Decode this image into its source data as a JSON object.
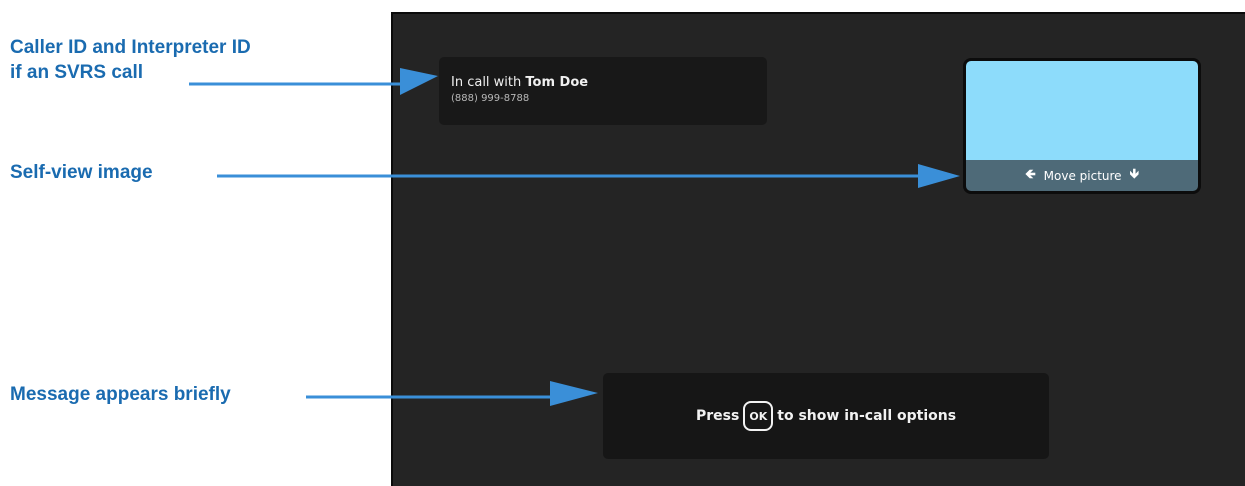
{
  "callouts": {
    "caller_line1": "Caller ID and Interpreter ID",
    "caller_line2": "if an SVRS call",
    "selfview": "Self-view image",
    "message": "Message appears briefly"
  },
  "screen": {
    "caller": {
      "prefix": "In call with ",
      "name": "Tom Doe",
      "number": "(888) 999-8788"
    },
    "selfview": {
      "move_label": "Move picture",
      "left_icon": "arrow-left-icon",
      "down_icon": "arrow-down-icon"
    },
    "message": {
      "before": "Press",
      "key": "OK",
      "after": "to show in-call options"
    }
  },
  "colors": {
    "callout_text": "#1a6bb0",
    "arrow": "#3a8fd8",
    "screen_bg": "#242424",
    "selfview_image": "#8ddcfb",
    "move_bar": "#4e6a78"
  }
}
